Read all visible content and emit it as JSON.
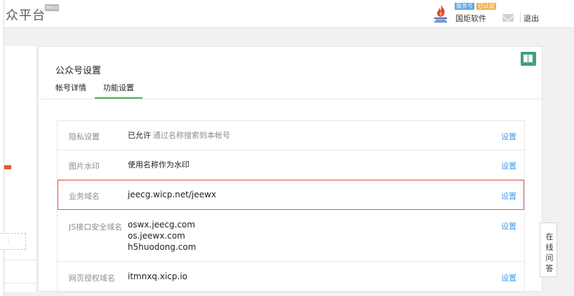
{
  "header": {
    "brand": "众平台",
    "beta": "Beta",
    "tags": [
      "服务号",
      "已认证"
    ],
    "account_name": "国炬软件",
    "logout": "退出"
  },
  "main": {
    "title": "公众号设置",
    "tabs": [
      {
        "label": "帐号详情",
        "active": false
      },
      {
        "label": "功能设置",
        "active": true
      }
    ],
    "rows": [
      {
        "label": "隐私设置",
        "values": [
          "已允许"
        ],
        "sub": "通过名称搜索到本帐号",
        "action": "设置"
      },
      {
        "label": "图片水印",
        "values": [
          "使用名称作为水印"
        ],
        "action": "设置"
      },
      {
        "label": "业务域名",
        "values": [
          "jeecg.wicp.net/jeewx"
        ],
        "action": "设置",
        "highlighted": true
      },
      {
        "label": "JS接口安全域名",
        "values": [
          "oswx.jeecg.com",
          "os.jeewx.com",
          "h5huodong.com"
        ],
        "action": "设置"
      },
      {
        "label": "网页授权域名",
        "values": [
          "itmnxq.xicp.io"
        ],
        "action": "设置"
      }
    ]
  },
  "help": {
    "chars": [
      "在",
      "线",
      "问",
      "答"
    ]
  },
  "colors": {
    "accent_green": "#44b549",
    "link_blue": "#459ae9",
    "highlight_red": "#e15a5a"
  }
}
